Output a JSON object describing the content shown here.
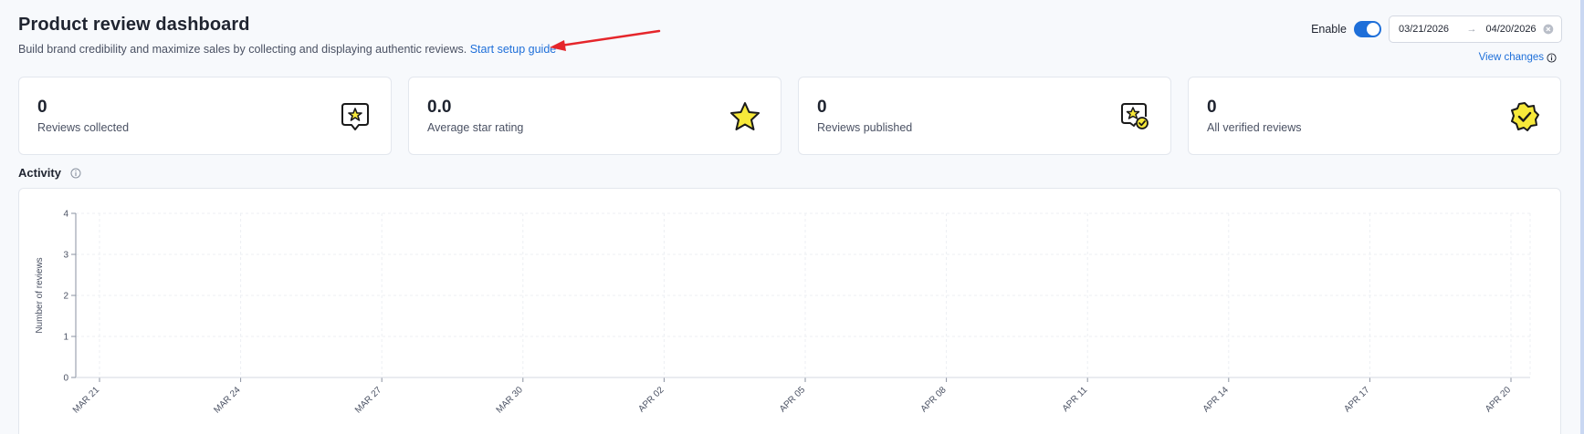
{
  "header": {
    "title": "Product review dashboard",
    "subtitle": "Build brand credibility and maximize sales by collecting and displaying authentic reviews.",
    "setup_link": "Start setup guide"
  },
  "controls": {
    "enable_label": "Enable",
    "enabled": true,
    "date_start": "03/21/2026",
    "date_sep": "→",
    "date_end": "04/20/2026",
    "view_changes": "View changes"
  },
  "cards": [
    {
      "value": "0",
      "label": "Reviews collected",
      "icon": "chat-star-icon"
    },
    {
      "value": "0.0",
      "label": "Average star rating",
      "icon": "star-icon"
    },
    {
      "value": "0",
      "label": "Reviews published",
      "icon": "chat-star-check-icon"
    },
    {
      "value": "0",
      "label": "All verified reviews",
      "icon": "verified-badge-icon"
    }
  ],
  "activity": {
    "title": "Activity",
    "info_icon": "info-icon"
  },
  "colors": {
    "accent": "#1e6fd9",
    "star_yellow": "#f7e93a",
    "annotation_arrow": "#e5262b"
  },
  "chart_data": {
    "type": "line",
    "xlabel": "",
    "ylabel": "Number of reviews",
    "categories": [
      "MAR 21",
      "MAR 24",
      "MAR 27",
      "MAR 30",
      "APR 02",
      "APR 05",
      "APR 08",
      "APR 11",
      "APR 14",
      "APR 17",
      "APR 20"
    ],
    "y_ticks": [
      "0",
      "1",
      "2",
      "3",
      "4"
    ],
    "ylim": [
      0,
      4
    ],
    "grid": true,
    "series": []
  }
}
